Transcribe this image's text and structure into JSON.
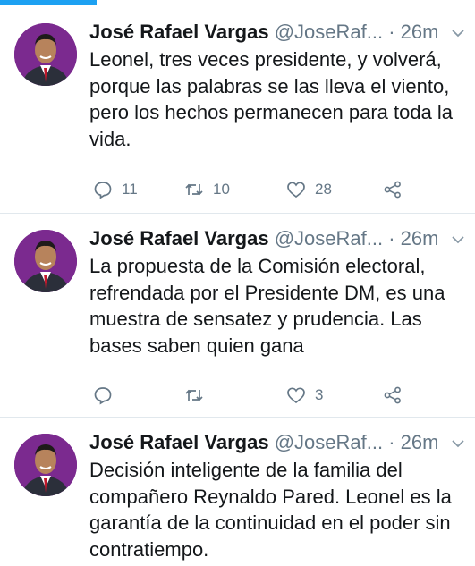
{
  "tweets": [
    {
      "name": "José Rafael Vargas",
      "handle": "@JoseRaf...",
      "dot": "·",
      "time": "26m",
      "text": "Leonel, tres veces presidente, y volverá, porque las palabras se las lleva el viento, pero los hechos permanecen para toda la vida.",
      "reply_count": "11",
      "retweet_count": "10",
      "like_count": "28"
    },
    {
      "name": "José Rafael Vargas",
      "handle": "@JoseRaf...",
      "dot": "·",
      "time": "26m",
      "text": "La propuesta de la Comisión electoral, refrendada por el Presidente DM, es una muestra de sensatez y prudencia. Las bases saben  quien gana",
      "reply_count": "",
      "retweet_count": "",
      "like_count": "3"
    },
    {
      "name": "José Rafael Vargas",
      "handle": "@JoseRaf...",
      "dot": "·",
      "time": "26m",
      "text": "Decisión inteligente de la familia del compañero Reynaldo Pared. Leonel es la garantía de la continuidad en el poder sin contratiempo.",
      "reply_count": "",
      "retweet_count": "",
      "like_count": ""
    }
  ],
  "colors": {
    "accent": "#1da1f2",
    "text": "#14171a",
    "muted": "#657786",
    "avatar_bg": "#7b2a8f"
  },
  "icons": {
    "reply": "reply-icon",
    "retweet": "retweet-icon",
    "like": "like-icon",
    "share": "share-icon",
    "caret": "chevron-down-icon"
  }
}
